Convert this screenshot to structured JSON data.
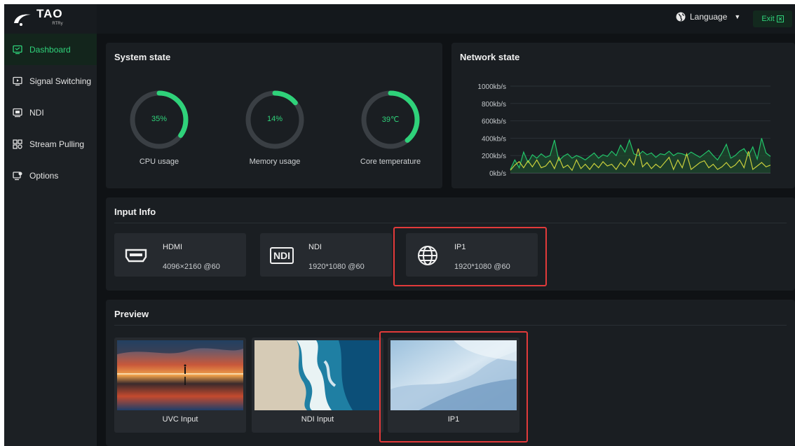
{
  "app": {
    "logo": "TAO",
    "logo_sub": "RTRy",
    "accent": "#2fd27a"
  },
  "header": {
    "language_label": "Language",
    "exit_label": "Exit"
  },
  "sidebar": {
    "items": [
      {
        "label": "Dashboard",
        "icon": "dashboard-icon",
        "active": true
      },
      {
        "label": "Signal Switching",
        "icon": "signal-switch-icon",
        "active": false
      },
      {
        "label": "NDI",
        "icon": "ndi-icon",
        "active": false
      },
      {
        "label": "Stream Pulling",
        "icon": "stream-icon",
        "active": false
      },
      {
        "label": "Options",
        "icon": "options-icon",
        "active": false
      }
    ]
  },
  "system_state": {
    "title": "System state",
    "gauges": [
      {
        "label": "CPU usage",
        "value_text": "35%",
        "fraction": 0.35
      },
      {
        "label": "Memory usage",
        "value_text": "14%",
        "fraction": 0.14
      },
      {
        "label": "Core temperature",
        "value_text": "39℃",
        "fraction": 0.39
      }
    ]
  },
  "network_state": {
    "title": "Network state"
  },
  "chart_data": {
    "type": "line",
    "title": "Network state",
    "ylim": [
      0,
      1000
    ],
    "y_ticks": [
      "1000kb/s",
      "800kb/s",
      "600kb/s",
      "400kb/s",
      "200kb/s",
      "0kb/s"
    ],
    "grid": true,
    "x": [
      0,
      1,
      2,
      3,
      4,
      5,
      6,
      7,
      8,
      9,
      10,
      11,
      12,
      13,
      14,
      15,
      16,
      17,
      18,
      19,
      20,
      21,
      22,
      23,
      24,
      25,
      26,
      27,
      28,
      29,
      30,
      31,
      32,
      33,
      34,
      35,
      36,
      37,
      38,
      39,
      40,
      41,
      42,
      43,
      44,
      45,
      46,
      47,
      48,
      49,
      50,
      51,
      52,
      53,
      54,
      55,
      56,
      57,
      58,
      59
    ],
    "series": [
      {
        "color": "#22c46a",
        "values": [
          40,
          150,
          60,
          240,
          120,
          210,
          170,
          220,
          180,
          200,
          380,
          140,
          190,
          220,
          170,
          200,
          180,
          150,
          190,
          230,
          170,
          210,
          190,
          250,
          200,
          320,
          240,
          380,
          220,
          200,
          250,
          210,
          230,
          180,
          220,
          210,
          250,
          200,
          230,
          220,
          200,
          240,
          210,
          180,
          220,
          260,
          200,
          150,
          230,
          330,
          170,
          200,
          250,
          280,
          200,
          300,
          160,
          400,
          230,
          190
        ]
      },
      {
        "color": "#c9cf3c",
        "values": [
          30,
          90,
          130,
          60,
          140,
          70,
          150,
          60,
          80,
          140,
          50,
          180,
          60,
          90,
          30,
          150,
          50,
          100,
          40,
          110,
          60,
          130,
          80,
          100,
          40,
          120,
          70,
          160,
          90,
          280,
          70,
          120,
          50,
          100,
          60,
          120,
          180,
          40,
          150,
          60,
          220,
          40,
          80,
          120,
          140,
          60,
          100,
          40,
          70,
          120,
          60,
          90,
          150,
          60,
          250,
          40,
          80,
          120,
          70,
          90
        ]
      }
    ]
  },
  "input_info": {
    "title": "Input Info",
    "cards": [
      {
        "name": "HDMI",
        "resolution": "4096×2160 @60",
        "icon": "hdmi-icon"
      },
      {
        "name": "NDI",
        "resolution": "1920*1080 @60",
        "icon": "ndi-logo-icon",
        "icon_text": "NDI"
      },
      {
        "name": "IP1",
        "resolution": "1920*1080 @60",
        "icon": "globe-icon"
      }
    ]
  },
  "preview": {
    "title": "Preview",
    "cards": [
      {
        "label": "UVC Input"
      },
      {
        "label": "NDI Input"
      },
      {
        "label": "IP1"
      }
    ]
  }
}
